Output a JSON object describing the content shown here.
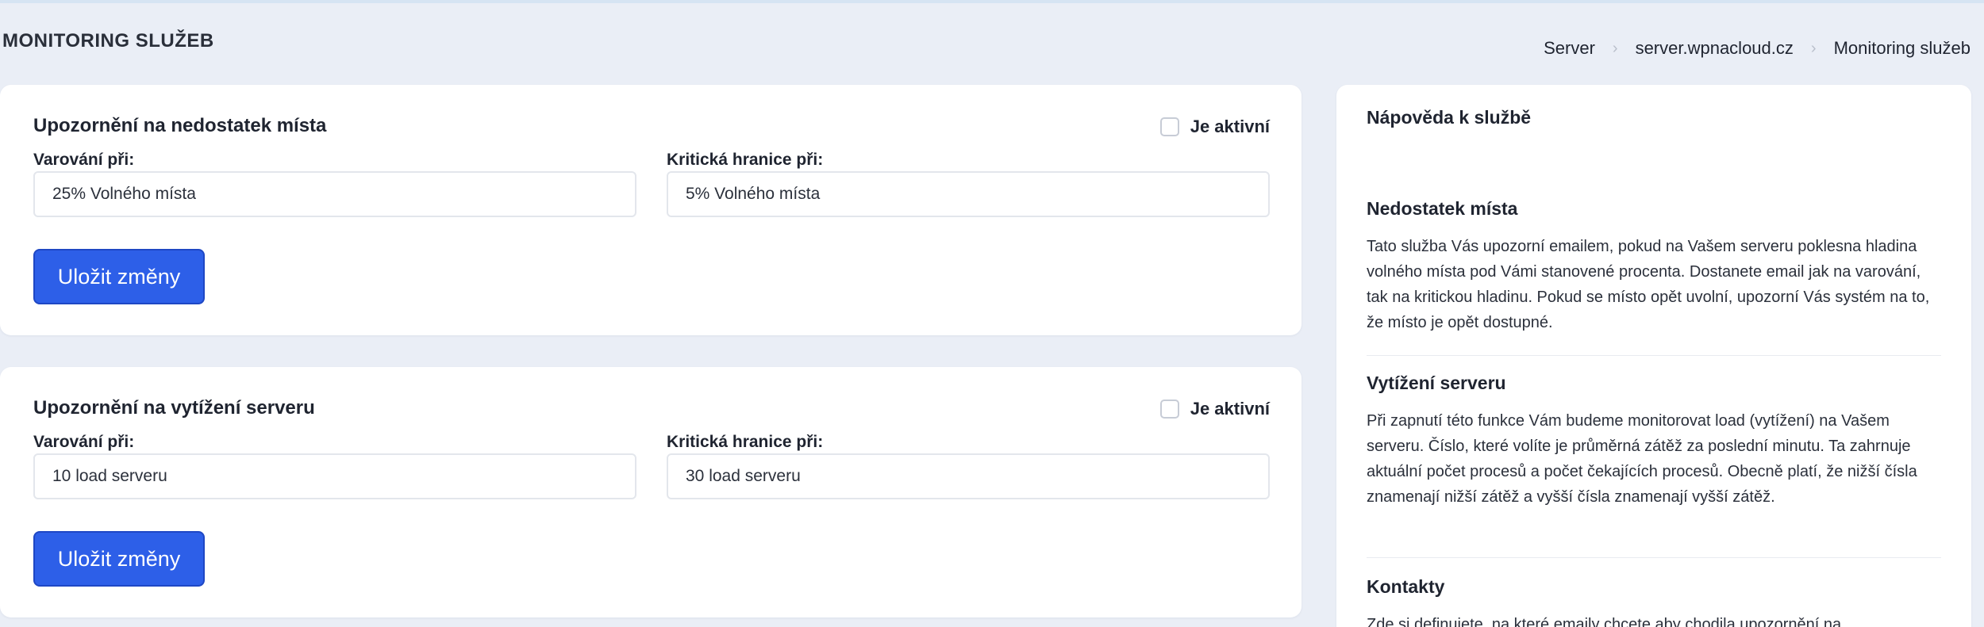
{
  "page": {
    "title": "MONITORING SLUŽEB"
  },
  "breadcrumb": {
    "items": [
      "Server",
      "server.wpnacloud.cz",
      "Monitoring služeb"
    ],
    "separator": "›"
  },
  "disk_card": {
    "title": "Upozornění na nedostatek místa",
    "active_label": "Je aktivní",
    "active_checked": false,
    "warning_label": "Varování při:",
    "warning_value": "25% Volného místa",
    "critical_label": "Kritická hranice při:",
    "critical_value": "5% Volného místa",
    "save_label": "Uložit změny"
  },
  "load_card": {
    "title": "Upozornění na vytížení serveru",
    "active_label": "Je aktivní",
    "active_checked": false,
    "warning_label": "Varování při:",
    "warning_value": "10 load serveru",
    "critical_label": "Kritická hranice při:",
    "critical_value": "30 load serveru",
    "save_label": "Uložit změny"
  },
  "help": {
    "title": "Nápověda k službě",
    "sections": [
      {
        "heading": "Nedostatek místa",
        "body": "Tato služba Vás upozorní emailem, pokud na Vašem serveru poklesna hladina volného místa pod Vámi stanovené procenta. Dostanete email jak na varování, tak na kritickou hladinu. Pokud se místo opět uvolní, upozorní Vás systém na to, že místo je opět dostupné."
      },
      {
        "heading": "Vytížení serveru",
        "body": "Při zapnutí této funkce Vám budeme monitorovat load (vytížení) na Vašem serveru. Číslo, které volíte je průměrná zátěž za poslední minutu. Ta zahrnuje aktuální počet procesů a počet čekajících procesů. Obecně platí, že nižší čísla znamenají nižší zátěž a vyšší čísla znamenají vyšší zátěž."
      },
      {
        "heading": "Kontakty",
        "body": "Zde si definujete, na které emaily chcete aby chodila upozornění na"
      }
    ]
  },
  "colors": {
    "background": "#eaeef6",
    "card": "#ffffff",
    "primary_button": "#2d5fe8"
  }
}
